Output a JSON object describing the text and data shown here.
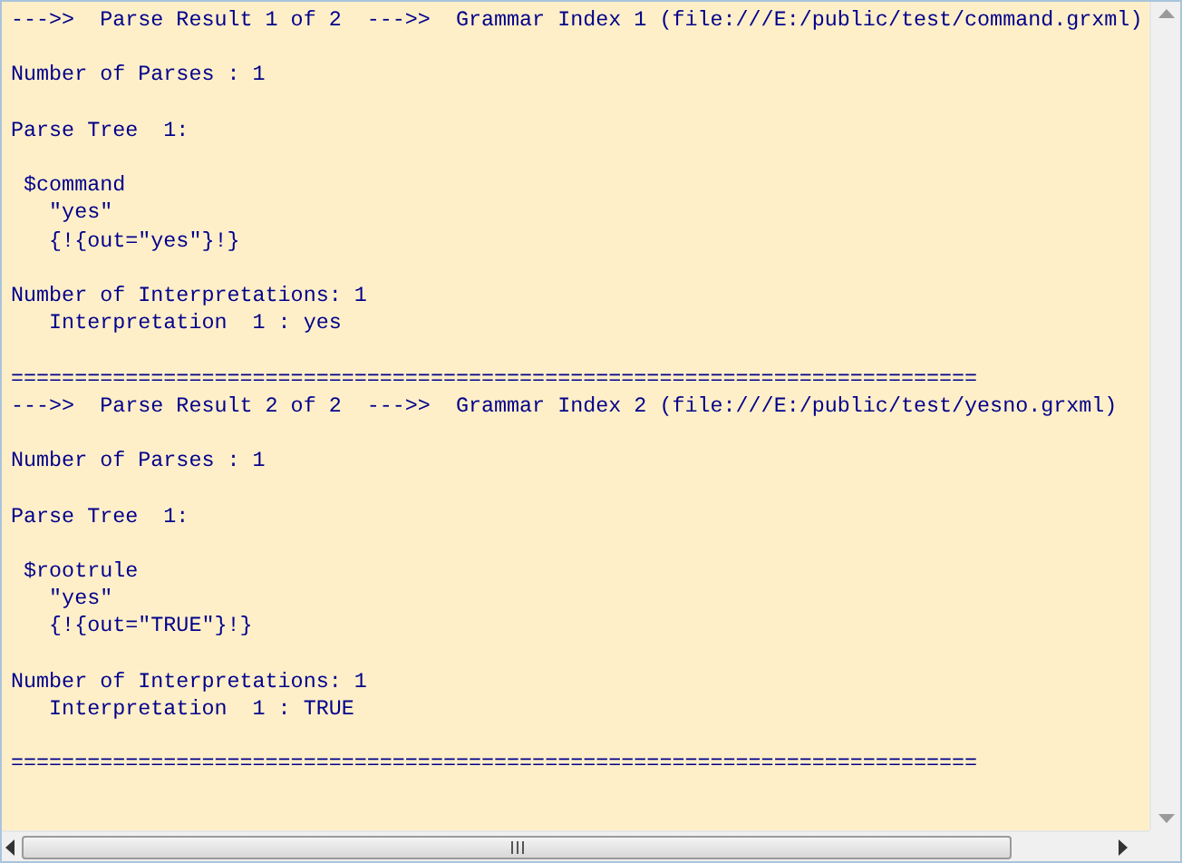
{
  "output": {
    "blocks": [
      [
        "--->>  Parse Result 1 of 2  --->>  Grammar Index 1 (file:///E:/public/test/command.grxml)"
      ],
      [
        "Number of Parses : 1"
      ],
      [
        "Parse Tree  1:"
      ],
      [
        " $command",
        "   \"yes\"",
        "   {!{out=\"yes\"}!}"
      ],
      [
        "Number of Interpretations: 1",
        "   Interpretation  1 : yes"
      ],
      [
        "============================================================================",
        "--->>  Parse Result 2 of 2  --->>  Grammar Index 2 (file:///E:/public/test/yesno.grxml)"
      ],
      [
        "Number of Parses : 1"
      ],
      [
        "Parse Tree  1:"
      ],
      [
        " $rootrule",
        "   \"yes\"",
        "   {!{out=\"TRUE\"}!}"
      ],
      [
        "Number of Interpretations: 1",
        "   Interpretation  1 : TRUE"
      ],
      [
        "============================================================================"
      ]
    ]
  }
}
